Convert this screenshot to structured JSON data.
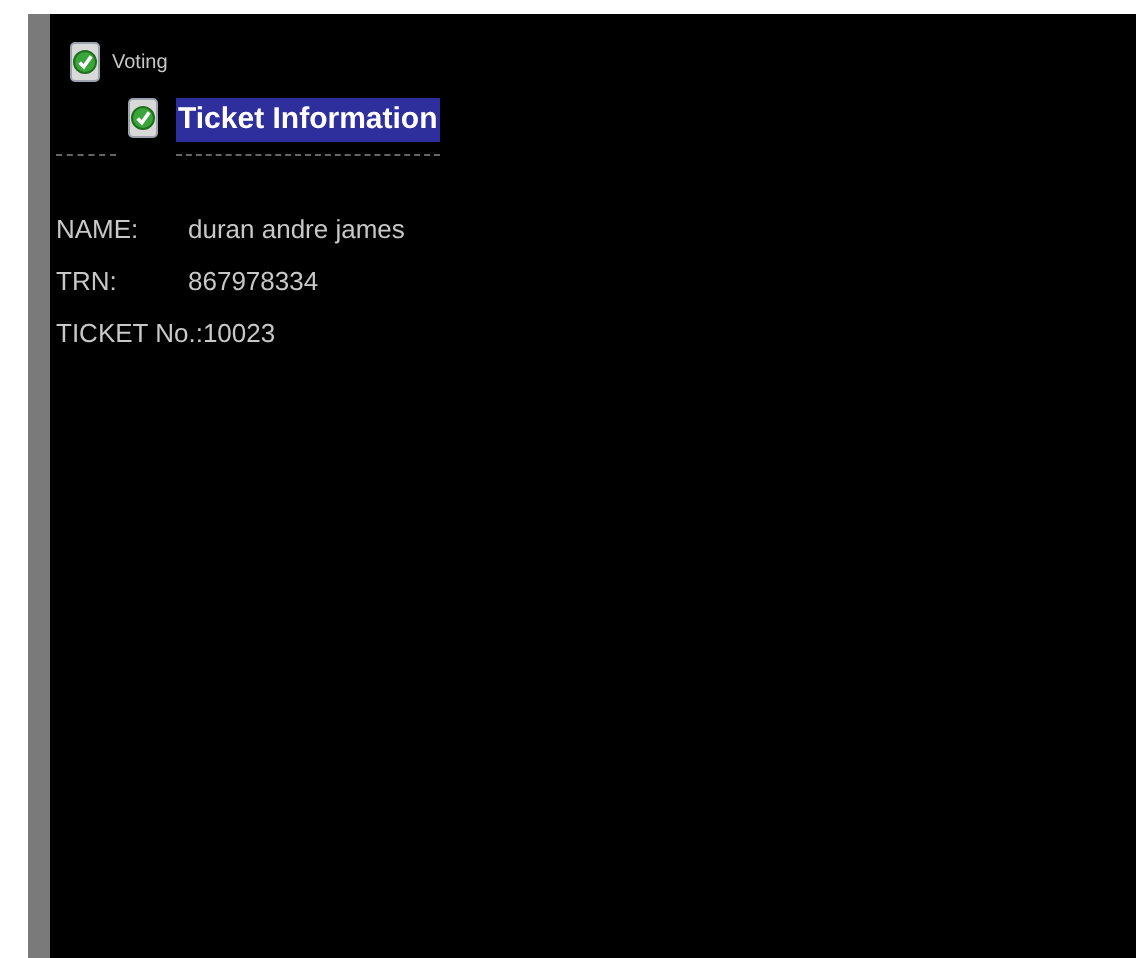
{
  "app": {
    "title": "Voting"
  },
  "header": {
    "title": "Ticket Information"
  },
  "fields": [
    {
      "label": "NAME:",
      "value": "duran andre james"
    },
    {
      "label": "TRN:",
      "value": "867978334"
    },
    {
      "label": "TICKET No.:",
      "value": "10023"
    }
  ]
}
